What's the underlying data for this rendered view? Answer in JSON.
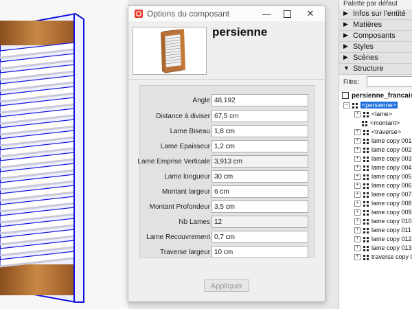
{
  "dialog": {
    "title": "Options du composant",
    "component_name": "persienne",
    "apply_label": "Appliquer",
    "fields": [
      {
        "label": "Angle",
        "value": "48,192",
        "readonly": false
      },
      {
        "label": "Distance à diviser",
        "value": "67,5 cm",
        "readonly": false
      },
      {
        "label": "Lame Biseau",
        "value": "1,8 cm",
        "readonly": false
      },
      {
        "label": "Lame Epaisseur",
        "value": "1,2 cm",
        "readonly": false
      },
      {
        "label": "Lame Emprise Verticale",
        "value": "3,913 cm",
        "readonly": true
      },
      {
        "label": "Lame longueur",
        "value": "30 cm",
        "readonly": false
      },
      {
        "label": "Montant largeur",
        "value": "6 cm",
        "readonly": false
      },
      {
        "label": "Montant Profondeur",
        "value": "3,5 cm",
        "readonly": false
      },
      {
        "label": "Nb Lames",
        "value": "12",
        "readonly": true
      },
      {
        "label": "Lame Recouvrement",
        "value": "0,7 cm",
        "readonly": false
      },
      {
        "label": "Traverse largeur",
        "value": "10 cm",
        "readonly": false
      }
    ]
  },
  "palette": {
    "title": "Palette par défaut",
    "sections": [
      {
        "label": "Infos sur l'entité",
        "expanded": false
      },
      {
        "label": "Matières",
        "expanded": false
      },
      {
        "label": "Composants",
        "expanded": false
      },
      {
        "label": "Styles",
        "expanded": false
      },
      {
        "label": "Scènes",
        "expanded": false
      },
      {
        "label": "Structure",
        "expanded": true
      }
    ],
    "filter_label": "Filtre:",
    "tree": {
      "root": "persienne_francaise",
      "selected": "<persienne>",
      "children": [
        "<lame>",
        "<montant>",
        "<traverse>",
        "lame copy 001",
        "lame copy 002",
        "lame copy 003",
        "lame copy 004",
        "lame copy 005",
        "lame copy 006",
        "lame copy 007",
        "lame copy 008",
        "lame copy 009",
        "lame copy 010",
        "lame copy 011",
        "lame copy 012",
        "lame copy 013",
        "traverse copy 0"
      ]
    }
  },
  "colors": {
    "selection": "#1c6fdc",
    "wood": "#b87333",
    "model_edge": "#1010e0"
  }
}
